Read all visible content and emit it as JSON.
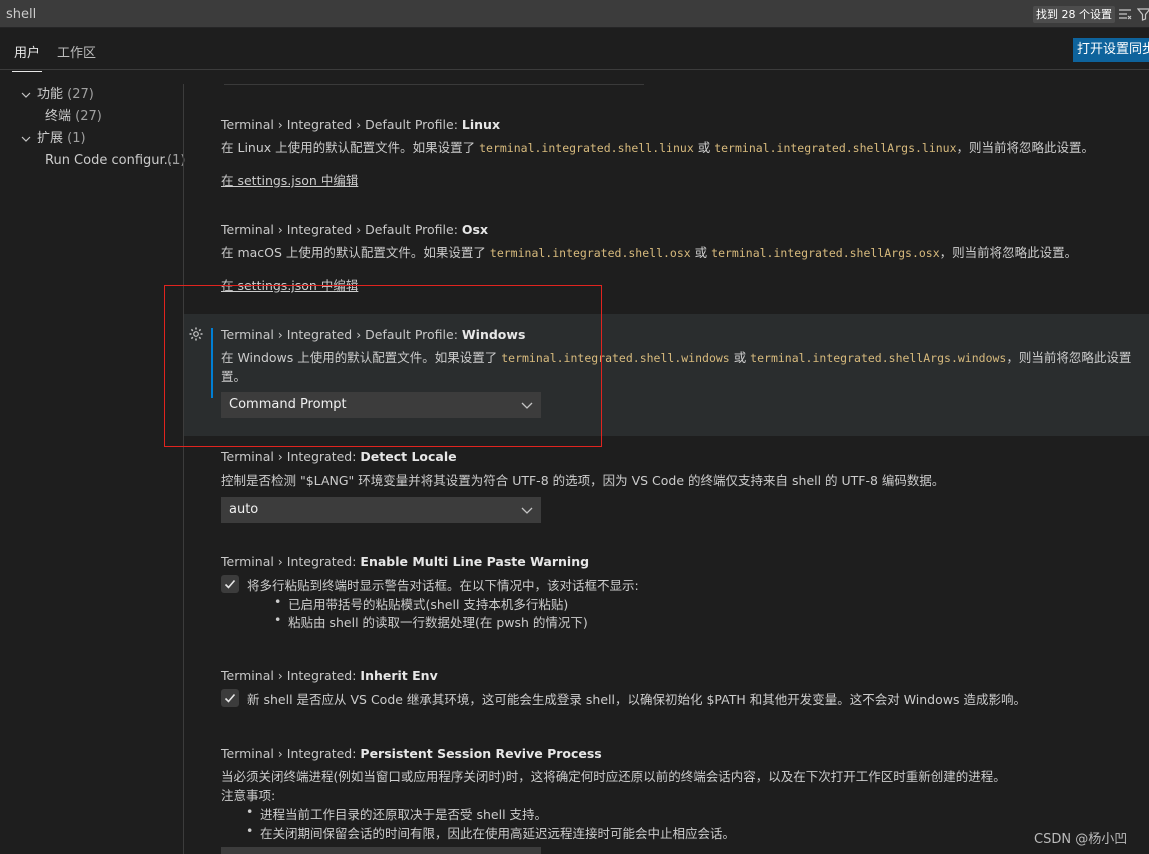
{
  "search": {
    "value": "shell",
    "result_count": "找到 28 个设置"
  },
  "tabs": {
    "user": "用户",
    "workspace": "工作区",
    "sync_button": "打开设置同步"
  },
  "toc": [
    {
      "label": "功能",
      "count": "(27)"
    },
    {
      "label": "终端",
      "count": "(27)"
    },
    {
      "label": "扩展",
      "count": "(1)"
    },
    {
      "label": "Run Code configur...",
      "count": "(1)"
    }
  ],
  "settings": {
    "linux": {
      "prefix": "Terminal › Integrated › Default Profile: ",
      "name": "Linux",
      "desc_a": "在 Linux 上使用的默认配置文件。如果设置了 ",
      "code_a": "terminal.integrated.shell.linux",
      "desc_b": " 或 ",
      "code_b": "terminal.integrated.shellArgs.linux",
      "desc_c": "，则当前将忽略此设置。",
      "link": "在 settings.json 中编辑"
    },
    "osx": {
      "prefix": "Terminal › Integrated › Default Profile: ",
      "name": "Osx",
      "desc_a": "在 macOS 上使用的默认配置文件。如果设置了 ",
      "code_a": "terminal.integrated.shell.osx",
      "desc_b": " 或 ",
      "code_b": "terminal.integrated.shellArgs.osx",
      "desc_c": "，则当前将忽略此设置。",
      "link": "在 settings.json 中编辑"
    },
    "windows": {
      "prefix": "Terminal › Integrated › Default Profile: ",
      "name": "Windows",
      "desc_a": "在 Windows 上使用的默认配置文件。如果设置了 ",
      "code_a": "terminal.integrated.shell.windows",
      "desc_b": " 或 ",
      "code_b": "terminal.integrated.shellArgs.windows",
      "desc_c": "，则当前将忽略此设置",
      "desc_wrap": "置。",
      "value": "Command Prompt"
    },
    "detect_locale": {
      "prefix": "Terminal › Integrated: ",
      "name": "Detect Locale",
      "desc": "控制是否检测 \"$LANG\" 环境变量并将其设置为符合 UTF-8 的选项，因为 VS Code 的终端仅支持来自 shell 的 UTF-8 编码数据。",
      "value": "auto"
    },
    "multi_line_paste": {
      "prefix": "Terminal › Integrated: ",
      "name": "Enable Multi Line Paste Warning",
      "desc": "将多行粘贴到终端时显示警告对话框。在以下情况中，该对话框不显示:",
      "bullets": [
        "已启用带括号的粘贴模式(shell 支持本机多行粘贴)",
        "粘贴由 shell 的读取一行数据处理(在 pwsh 的情况下)"
      ]
    },
    "inherit_env": {
      "prefix": "Terminal › Integrated: ",
      "name": "Inherit Env",
      "desc": "新 shell 是否应从 VS Code 继承其环境，这可能会生成登录 shell，以确保初始化 $PATH 和其他开发变量。这不会对 Windows 造成影响。"
    },
    "persistent_session": {
      "prefix": "Terminal › Integrated: ",
      "name": "Persistent Session Revive Process",
      "desc": "当必须关闭终端进程(例如当窗口或应用程序关闭时)时，这将确定何时应还原以前的终端会话内容，以及在下次打开工作区时重新创建的进程。",
      "note": "注意事项:",
      "bullets": [
        "进程当前工作目录的还原取决于是否受 shell 支持。",
        "在关闭期间保留会话的时间有限，因此在使用高延迟远程连接时可能会中止相应会话。"
      ]
    }
  },
  "watermark": "CSDN @杨小凹",
  "colors": {
    "background": "#1e1e1e",
    "accent": "#0e639c",
    "code": "#d7ba7d",
    "highlight": "#e0241f"
  }
}
